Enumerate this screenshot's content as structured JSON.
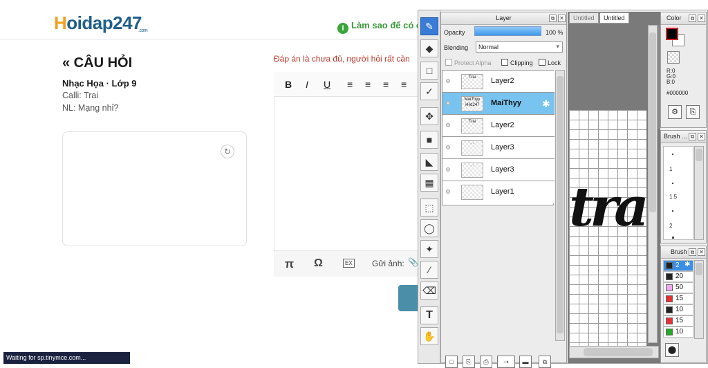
{
  "site": {
    "logo_h": "H",
    "logo_rest": "oidap",
    "logo_247": "247",
    "logo_com": ".com",
    "howto_text": "Làm sao để có c",
    "howto_icon": "i"
  },
  "question": {
    "title": "« CÂU HỎI",
    "subject": "Nhạc Họa · Lớp 9",
    "line1": "Calli: Trai",
    "line2": "NL: Mạng nhỉ?",
    "refresh_icon": "↻"
  },
  "answer": {
    "note": "Đáp án là chưa đủ, người hỏi rất cần",
    "toolbar": [
      "B",
      "I",
      "U",
      "≡",
      "≡",
      "≡",
      "≡"
    ],
    "footer_pi": "π",
    "footer_omega": "Ω",
    "footer_ex": "EX",
    "footer_send": "Gửi ảnh:",
    "footer_clip": "📎"
  },
  "status_bar": "Waiting for sp.tinymce.com...",
  "paint": {
    "tools": [
      "✎",
      "◆",
      "□",
      "✓",
      "✥",
      "■",
      "◣",
      "▦",
      "⬚",
      "◯",
      "✦",
      "⁄",
      "⌫",
      "T",
      "✋"
    ],
    "layer_panel": {
      "title": "Layer",
      "opacity_label": "Opacity",
      "opacity_value": "100 %",
      "opacity_level": 1.0,
      "blending_label": "Blending",
      "blending_value": "Normal",
      "protect_alpha": "Protect Alpha",
      "clipping": "Clipping",
      "lock": "Lock",
      "layers": [
        {
          "name": "Layer2",
          "thumb": "Trai",
          "selected": false
        },
        {
          "name": "MaiThyy",
          "thumb": "MaiThyy #Hd247",
          "selected": true
        },
        {
          "name": "Layer2",
          "thumb": "Trai",
          "selected": false
        },
        {
          "name": "Layer3",
          "thumb": "· ·",
          "selected": false
        },
        {
          "name": "Layer3",
          "thumb": "· ·",
          "selected": false
        },
        {
          "name": "Layer1",
          "thumb": "",
          "selected": false
        }
      ],
      "bottom_buttons": [
        "□",
        "⎘",
        "⎙",
        "⇢",
        "▬",
        "⧉"
      ]
    },
    "canvas": {
      "tab1": "Untitled",
      "tab2": "Untitled",
      "text": "tra"
    },
    "color_panel": {
      "title": "Color",
      "r": "R:0",
      "g": "G:0",
      "b": "B:0",
      "hex": "#000000",
      "btn1": "⚙",
      "btn2": "⎘"
    },
    "brush_size_panel": {
      "title": "Brush ...",
      "sizes": [
        "1",
        "1.5",
        "2"
      ]
    },
    "brush_panel": {
      "title": "Brush",
      "items": [
        {
          "color": "#222222",
          "value": "2",
          "selected": true
        },
        {
          "color": "#222222",
          "value": "20",
          "selected": false
        },
        {
          "color": "#f5a8f0",
          "value": "50",
          "selected": false
        },
        {
          "color": "#e83030",
          "value": "15",
          "selected": false
        },
        {
          "color": "#222222",
          "value": "10",
          "selected": false
        },
        {
          "color": "#e83030",
          "value": "15",
          "selected": false
        },
        {
          "color": "#22aa22",
          "value": "10",
          "selected": false
        }
      ],
      "bottom_btn": "⬤"
    }
  }
}
